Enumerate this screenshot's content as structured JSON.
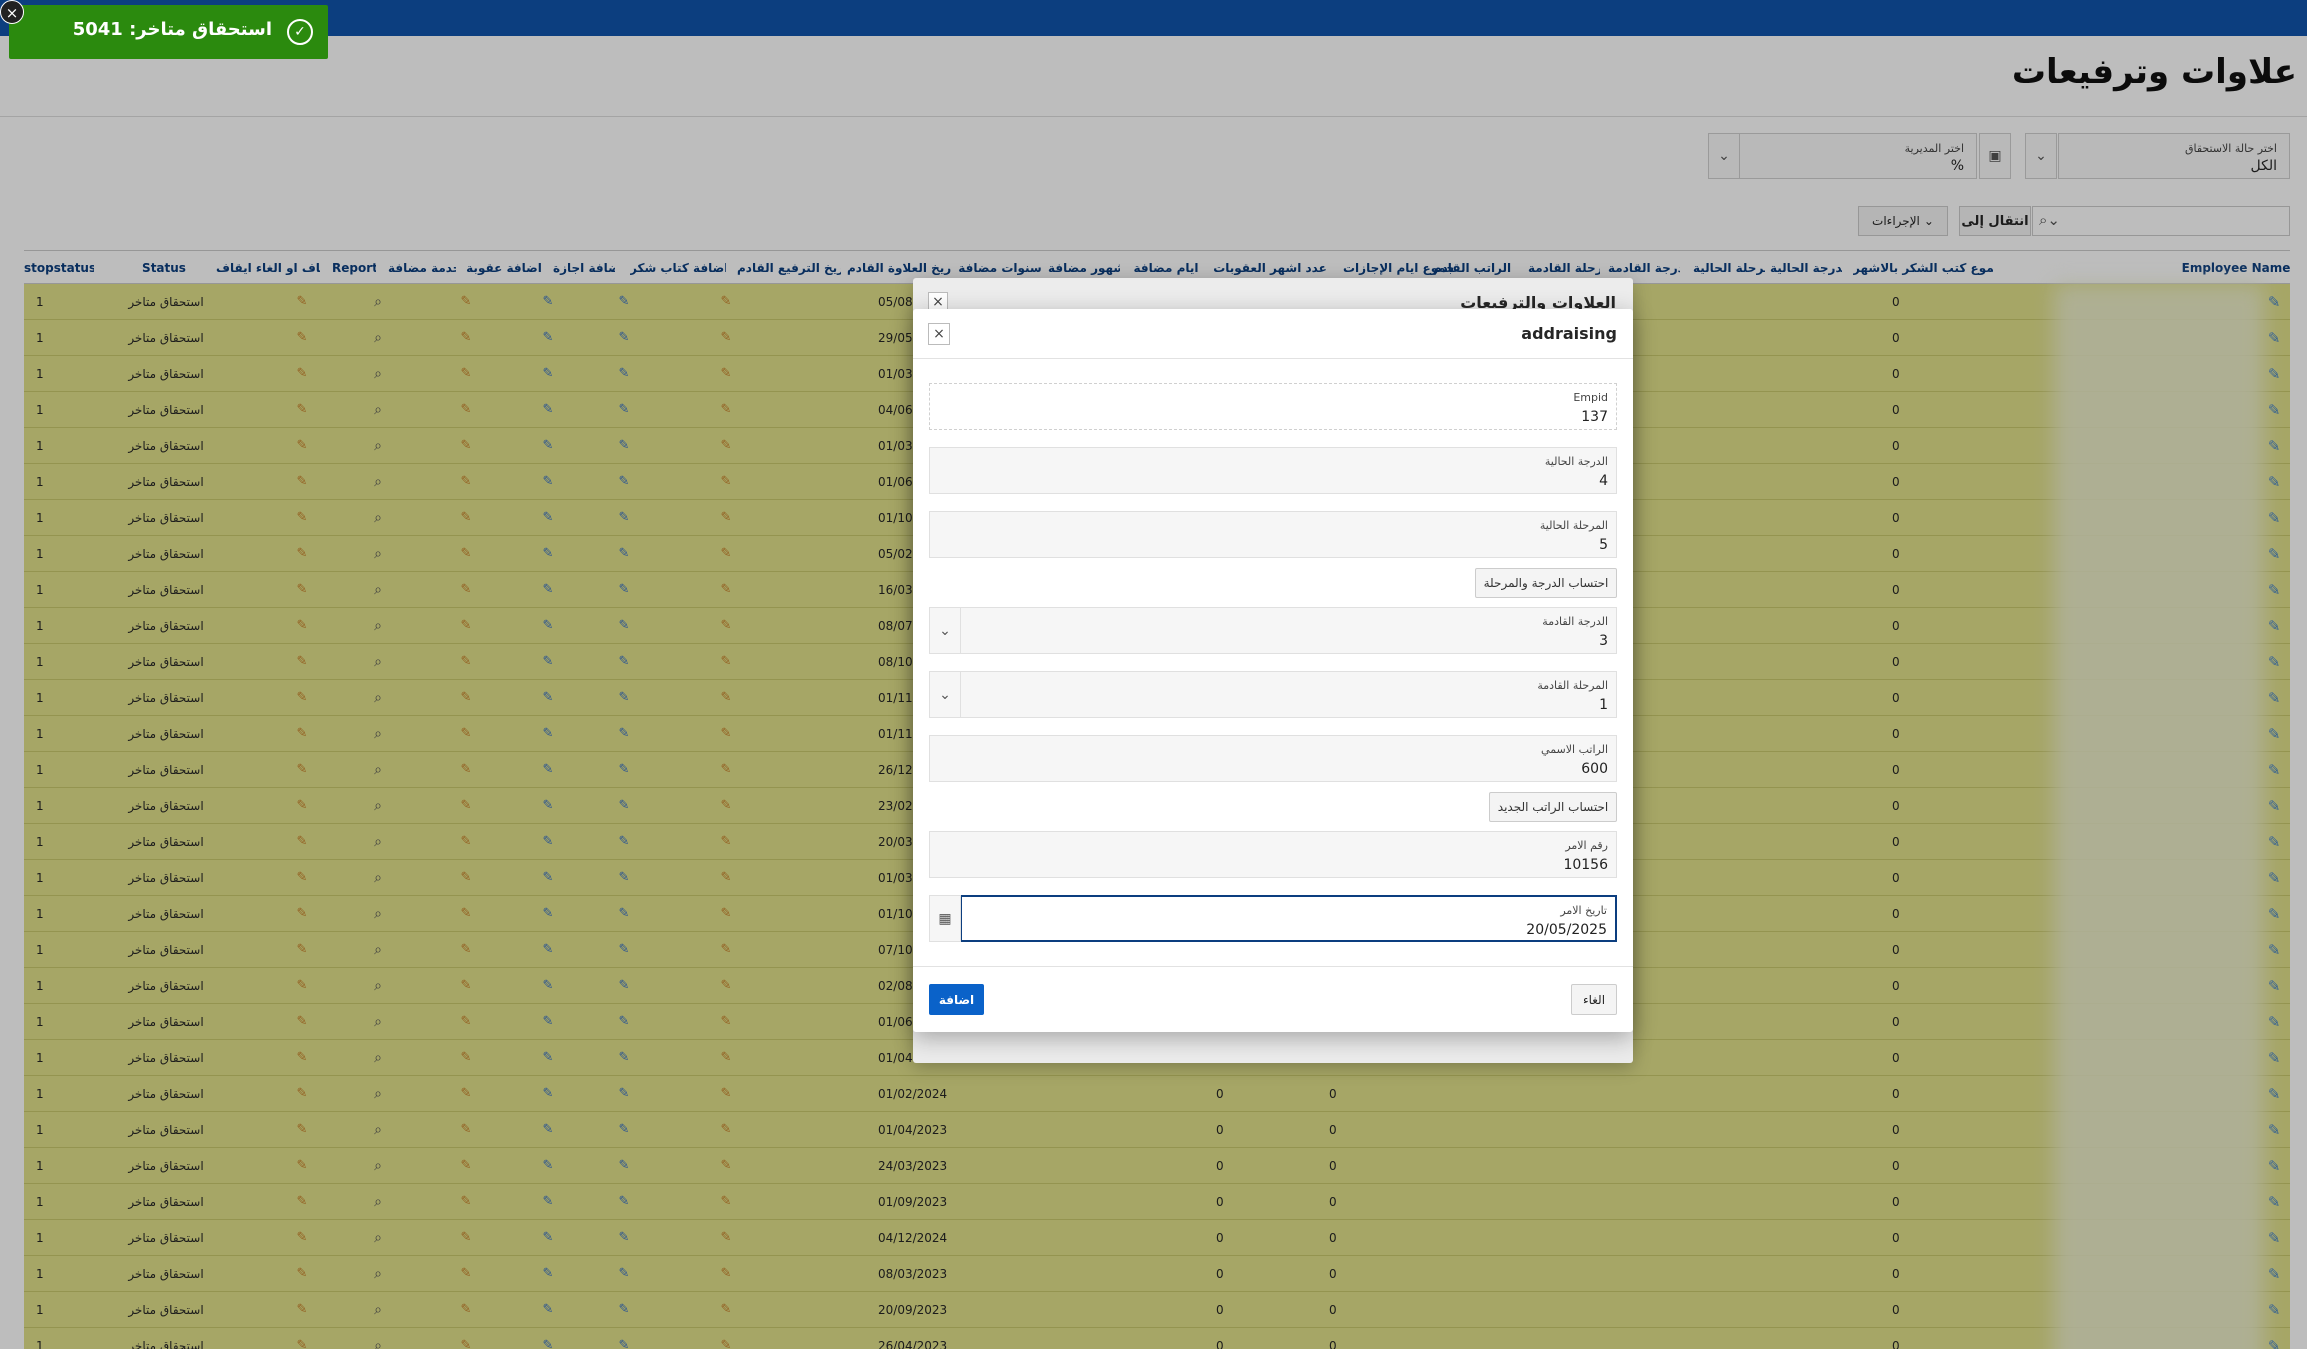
{
  "page": {
    "title": "علاوات وترفيعات"
  },
  "filters": {
    "status_label": "اختر حالة الاستحقاق",
    "status_value": "الكل",
    "dept_label": "اختر المديرية",
    "dept_value": "%"
  },
  "toolbar": {
    "goto_label": "انتقال إلى",
    "actions_label": "الإجراءات"
  },
  "grid": {
    "columns": [
      "Employee Name",
      "مجموع كتب الشكر بالاشهر",
      "الدرجة الحالية",
      "المرحلة الحالية",
      "الدرجة القادمة",
      "المرحلة القادمة",
      "الراتب القادم",
      "مجموع ايام الإجازات",
      "عدد اشهر العقوبات",
      "ايام مضافة",
      "شهور مضافة",
      "سنوات مضافة",
      "تاريخ العلاوة القادم",
      "تاريخ الترفيع القادم",
      "اضافة كتاب شكر",
      "اضافة اجازة",
      "اضافة عقوبة",
      "خدمة مضافة",
      "Report",
      "ايقاف او الغاء ايقاف",
      "Status",
      "stopstatus"
    ],
    "rows": [
      {
        "thanks": "0",
        "sanction": "",
        "leave": "",
        "date": "05/08",
        "status": "استحقاق متاخر",
        "stop": "1"
      },
      {
        "thanks": "0",
        "sanction": "",
        "leave": "",
        "date": "29/05",
        "status": "استحقاق متاخر",
        "stop": "1"
      },
      {
        "thanks": "0",
        "sanction": "",
        "leave": "",
        "date": "01/03",
        "status": "استحقاق متاخر",
        "stop": "1"
      },
      {
        "thanks": "0",
        "sanction": "",
        "leave": "",
        "date": "04/06",
        "status": "استحقاق متاخر",
        "stop": "1"
      },
      {
        "thanks": "0",
        "sanction": "",
        "leave": "",
        "date": "01/03",
        "status": "استحقاق متاخر",
        "stop": "1"
      },
      {
        "thanks": "0",
        "sanction": "",
        "leave": "",
        "date": "01/06",
        "status": "استحقاق متاخر",
        "stop": "1"
      },
      {
        "thanks": "0",
        "sanction": "",
        "leave": "",
        "date": "01/10",
        "status": "استحقاق متاخر",
        "stop": "1"
      },
      {
        "thanks": "0",
        "sanction": "",
        "leave": "",
        "date": "05/02",
        "status": "استحقاق متاخر",
        "stop": "1"
      },
      {
        "thanks": "0",
        "sanction": "",
        "leave": "",
        "date": "16/03",
        "status": "استحقاق متاخر",
        "stop": "1"
      },
      {
        "thanks": "0",
        "sanction": "",
        "leave": "",
        "date": "08/07",
        "status": "استحقاق متاخر",
        "stop": "1"
      },
      {
        "thanks": "0",
        "sanction": "",
        "leave": "",
        "date": "08/10",
        "status": "استحقاق متاخر",
        "stop": "1"
      },
      {
        "thanks": "0",
        "sanction": "",
        "leave": "",
        "date": "01/11",
        "status": "استحقاق متاخر",
        "stop": "1"
      },
      {
        "thanks": "0",
        "sanction": "",
        "leave": "",
        "date": "01/11",
        "status": "استحقاق متاخر",
        "stop": "1"
      },
      {
        "thanks": "0",
        "sanction": "",
        "leave": "",
        "date": "26/12",
        "status": "استحقاق متاخر",
        "stop": "1"
      },
      {
        "thanks": "0",
        "sanction": "",
        "leave": "",
        "date": "23/02",
        "status": "استحقاق متاخر",
        "stop": "1"
      },
      {
        "thanks": "0",
        "sanction": "",
        "leave": "",
        "date": "20/03",
        "status": "استحقاق متاخر",
        "stop": "1"
      },
      {
        "thanks": "0",
        "sanction": "",
        "leave": "",
        "date": "01/03",
        "status": "استحقاق متاخر",
        "stop": "1"
      },
      {
        "thanks": "0",
        "sanction": "",
        "leave": "",
        "date": "01/10",
        "status": "استحقاق متاخر",
        "stop": "1"
      },
      {
        "thanks": "0",
        "sanction": "",
        "leave": "",
        "date": "07/10",
        "status": "استحقاق متاخر",
        "stop": "1"
      },
      {
        "thanks": "0",
        "sanction": "",
        "leave": "",
        "date": "02/08",
        "status": "استحقاق متاخر",
        "stop": "1"
      },
      {
        "thanks": "0",
        "sanction": "",
        "leave": "",
        "date": "01/06",
        "status": "استحقاق متاخر",
        "stop": "1"
      },
      {
        "thanks": "0",
        "sanction": "",
        "leave": "",
        "date": "01/04",
        "status": "استحقاق متاخر",
        "stop": "1"
      },
      {
        "thanks": "0",
        "sanction": "0",
        "leave": "0",
        "date": "01/02/2024",
        "status": "استحقاق متاخر",
        "stop": "1"
      },
      {
        "thanks": "0",
        "sanction": "0",
        "leave": "0",
        "date": "01/04/2023",
        "status": "استحقاق متاخر",
        "stop": "1"
      },
      {
        "thanks": "0",
        "sanction": "0",
        "leave": "0",
        "date": "24/03/2023",
        "status": "استحقاق متاخر",
        "stop": "1"
      },
      {
        "thanks": "0",
        "sanction": "0",
        "leave": "0",
        "date": "01/09/2023",
        "status": "استحقاق متاخر",
        "stop": "1"
      },
      {
        "thanks": "0",
        "sanction": "0",
        "leave": "0",
        "date": "04/12/2024",
        "status": "استحقاق متاخر",
        "stop": "1"
      },
      {
        "thanks": "0",
        "sanction": "0",
        "leave": "0",
        "date": "08/03/2023",
        "status": "استحقاق متاخر",
        "stop": "1"
      },
      {
        "thanks": "0",
        "sanction": "0",
        "leave": "0",
        "date": "20/09/2023",
        "status": "استحقاق متاخر",
        "stop": "1"
      },
      {
        "thanks": "0",
        "sanction": "0",
        "leave": "0",
        "date": "26/04/2023",
        "status": "استحقاق متاخر",
        "stop": "1"
      }
    ]
  },
  "toast": {
    "message": "استحقاق متاخر: 5041"
  },
  "outer_dialog": {
    "title": "العلاوات والترفيعات"
  },
  "dialog": {
    "title": "addraising",
    "fields": {
      "empid": {
        "label": "Empid",
        "value": "137"
      },
      "cur_grade": {
        "label": "الدرجة الحالية",
        "value": "4"
      },
      "cur_stage": {
        "label": "المرحلة الحالية",
        "value": "5"
      },
      "next_grade": {
        "label": "الدرجة القادمة",
        "value": "3"
      },
      "next_stage": {
        "label": "المرحلة القادمة",
        "value": "1"
      },
      "salary": {
        "label": "الراتب الاسمي",
        "value": "600"
      },
      "order_no": {
        "label": "رقم الامر",
        "value": "10156"
      },
      "order_date": {
        "label": "تاريخ الامر",
        "value": "20/05/2025"
      }
    },
    "calc_grade_label": "احتساب الدرجة والمرحلة",
    "calc_salary_label": "احتساب الراتب الجديد",
    "add_label": "اضافة",
    "cancel_label": "الغاء"
  },
  "colors": {
    "header": "#0c3e7f",
    "row": "#e0e08a",
    "toast": "#2b8a0e",
    "primary": "#0a62c9"
  },
  "icons": {
    "edit": "edit-icon",
    "pencil": "pencil-icon",
    "search": "search-icon",
    "calendar": "calendar-icon"
  }
}
